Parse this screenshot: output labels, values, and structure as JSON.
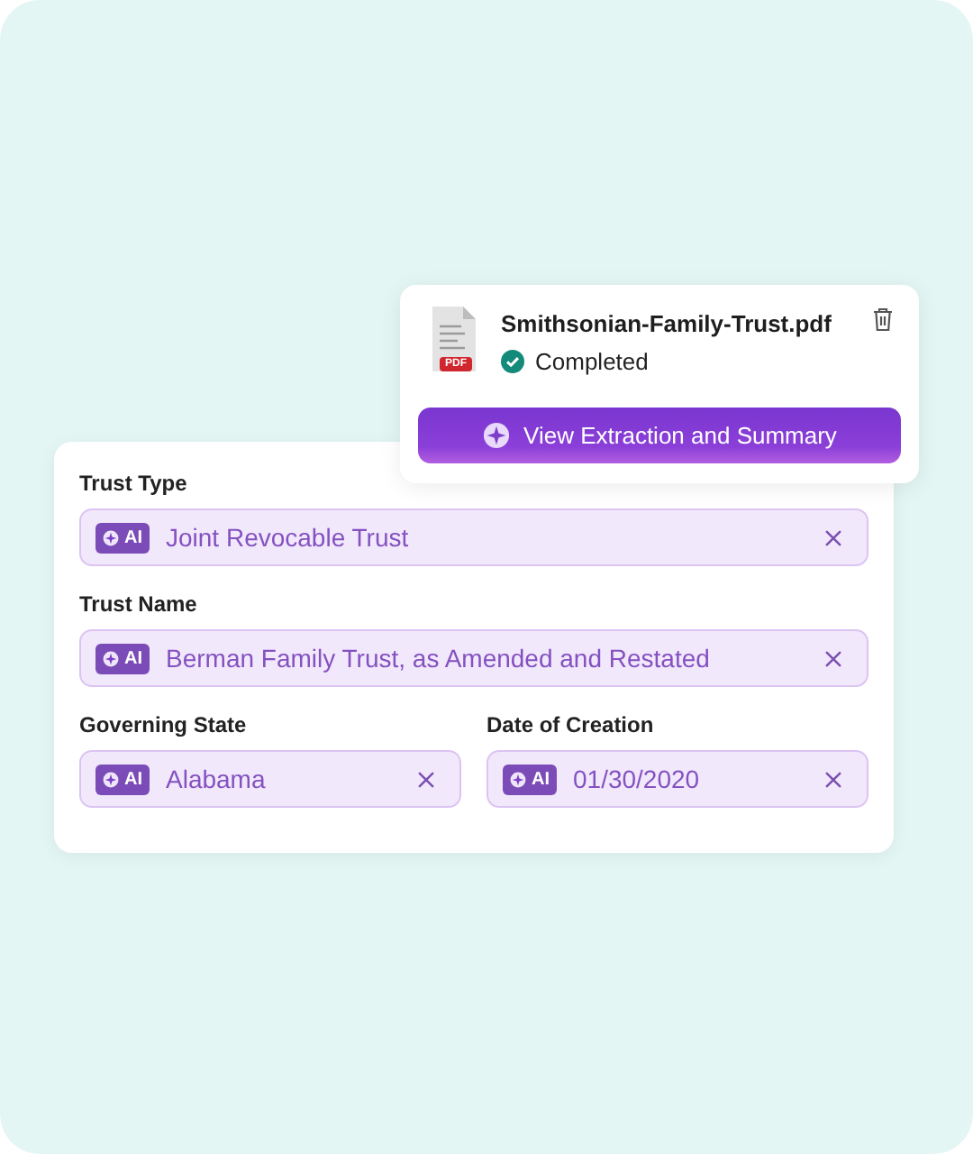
{
  "file_card": {
    "file_badge": "PDF",
    "file_name": "Smithsonian-Family-Trust.pdf",
    "status": "Completed",
    "button": "View Extraction and Summary"
  },
  "form": {
    "fields": [
      {
        "kind": "full",
        "label": "Trust Type",
        "badge": "AI",
        "value": "Joint Revocable Trust"
      },
      {
        "kind": "full",
        "label": "Trust Name",
        "badge": "AI",
        "value": "Berman Family Trust, as Amended and Restated"
      },
      {
        "kind": "half",
        "label": "Governing State",
        "badge": "AI",
        "value": "Alabama"
      },
      {
        "kind": "half",
        "label": "Date of Creation",
        "badge": "AI",
        "value": "01/30/2020"
      }
    ]
  }
}
